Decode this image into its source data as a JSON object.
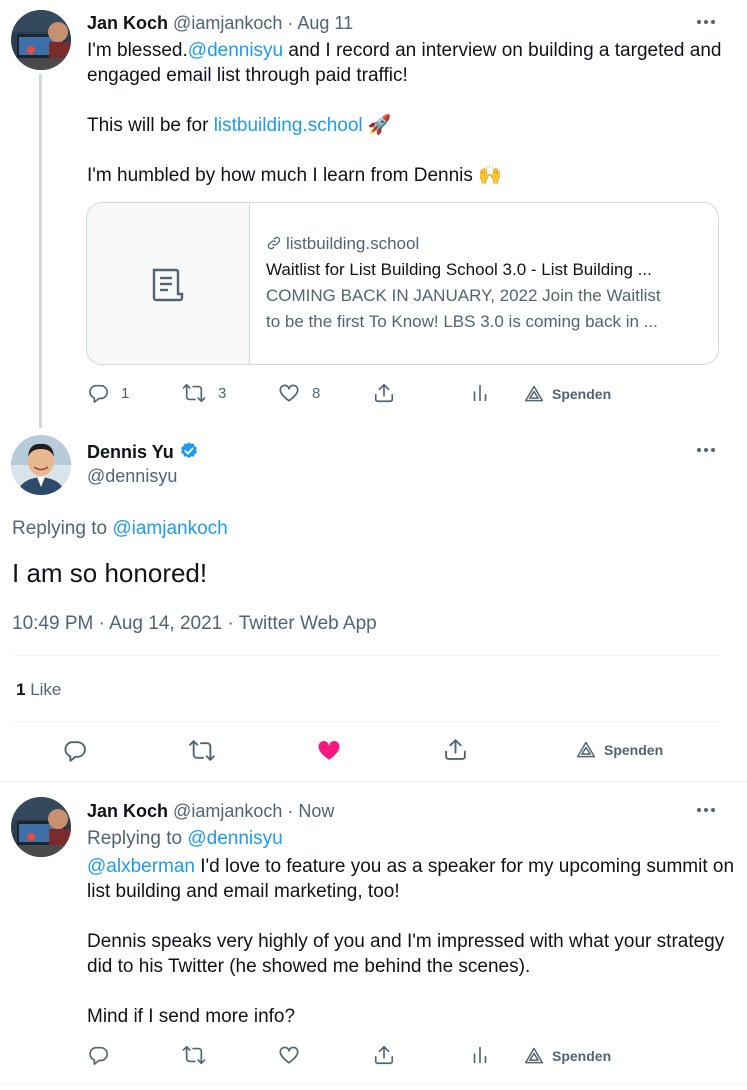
{
  "tweet1": {
    "author_name": "Jan Koch",
    "author_handle": "@iamjankoch",
    "dot": "·",
    "date": "Aug 11",
    "line1_prefix": "I'm blessed.",
    "line1_mention": "@dennisyu",
    "line1_suffix": " and I record an interview on building a targeted and",
    "line2": "engaged email list through paid traffic!",
    "line3_prefix": "This will be for ",
    "line3_link": "listbuilding.school",
    "line3_emoji": "🚀",
    "line4": "I'm humbled by how much I learn from Dennis",
    "line4_emoji": "🙌",
    "card": {
      "domain": "listbuilding.school",
      "title": "Waitlist for List Building School 3.0 - List Building ...",
      "desc1": "COMING BACK IN JANUARY, 2022 Join the Waitlist",
      "desc2": "to be the first To Know! LBS 3.0 is coming back in ..."
    },
    "replies": "1",
    "retweets": "3",
    "likes": "8",
    "spenden": "Spenden"
  },
  "tweet2": {
    "author_name": "Dennis Yu",
    "author_handle": "@dennisyu",
    "replying_to_label": "Replying to ",
    "replying_to_handle": "@iamjankoch",
    "text": "I am so honored!",
    "timestamp": "10:49 PM · Aug 14, 2021 · Twitter Web App",
    "like_count": "1",
    "like_label": " Like",
    "spenden": "Spenden"
  },
  "tweet3": {
    "author_name": "Jan Koch",
    "author_handle": "@iamjankoch",
    "dot": "·",
    "date": "Now",
    "replying_to_label": "Replying to ",
    "replying_to_handle": "@dennisyu",
    "line1_mention": "@alxberman",
    "line1_suffix": " I'd love to feature you as a speaker for my upcoming summit on",
    "line2": "list building and email marketing, too!",
    "line3": "Dennis speaks very highly of you and I'm impressed with what your strategy",
    "line4": "did to his Twitter (he showed me behind the scenes).",
    "line5": "Mind if I send more info?",
    "spenden": "Spenden"
  },
  "colors": {
    "link": "#1d9bf0",
    "muted": "#536471",
    "like_active": "#f91880",
    "verified": "#1d9bf0"
  },
  "icons": [
    "reply-icon",
    "retweet-icon",
    "like-icon",
    "share-icon",
    "analytics-icon",
    "spenden-icon",
    "more-icon",
    "verified-badge-icon",
    "link-icon",
    "document-icon"
  ]
}
